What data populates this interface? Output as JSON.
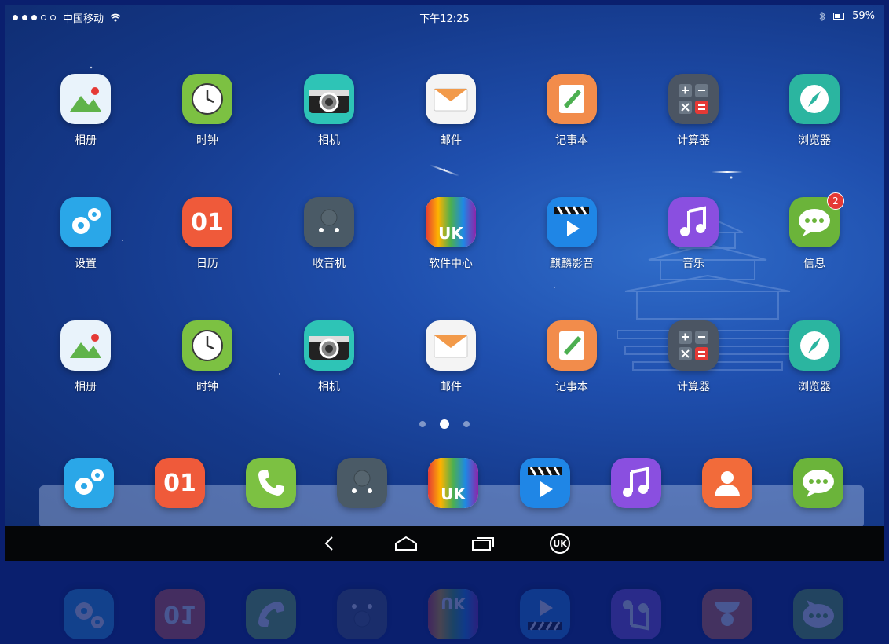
{
  "status_bar": {
    "carrier": "中国移动",
    "time": "下午12:25",
    "battery": "59%"
  },
  "home": {
    "rows": [
      [
        {
          "label": "相册",
          "icon": "gallery-icon",
          "color": "#e9f3fb"
        },
        {
          "label": "时钟",
          "icon": "clock-icon",
          "color": "#7cc142"
        },
        {
          "label": "相机",
          "icon": "camera-icon",
          "color": "#2ec4b6"
        },
        {
          "label": "邮件",
          "icon": "mail-icon",
          "color": "#f4f4f4"
        },
        {
          "label": "记事本",
          "icon": "notepad-icon",
          "color": "#f28c4b"
        },
        {
          "label": "计算器",
          "icon": "calculator-icon",
          "color": "#4b5563"
        },
        {
          "label": "浏览器",
          "icon": "browser-icon",
          "color": "#2bb5a0"
        }
      ],
      [
        {
          "label": "设置",
          "icon": "settings-icon",
          "color": "#2aa7e8"
        },
        {
          "label": "日历",
          "icon": "calendar-icon",
          "color": "#ef5a3a",
          "text": "01"
        },
        {
          "label": "收音机",
          "icon": "radio-icon",
          "color": "#4a5a66"
        },
        {
          "label": "软件中心",
          "icon": "app-store-icon",
          "color": "#ffffff",
          "text": "UK"
        },
        {
          "label": "麒麟影音",
          "icon": "video-player-icon",
          "color": "#1f86e6"
        },
        {
          "label": "音乐",
          "icon": "music-icon",
          "color": "#8a4fe0"
        },
        {
          "label": "信息",
          "icon": "messages-icon",
          "color": "#6bb43a",
          "badge": "2"
        }
      ],
      [
        {
          "label": "相册",
          "icon": "gallery-icon",
          "color": "#e9f3fb"
        },
        {
          "label": "时钟",
          "icon": "clock-icon",
          "color": "#7cc142"
        },
        {
          "label": "相机",
          "icon": "camera-icon",
          "color": "#2ec4b6"
        },
        {
          "label": "邮件",
          "icon": "mail-icon",
          "color": "#f4f4f4"
        },
        {
          "label": "记事本",
          "icon": "notepad-icon",
          "color": "#f28c4b"
        },
        {
          "label": "计算器",
          "icon": "calculator-icon",
          "color": "#4b5563"
        },
        {
          "label": "浏览器",
          "icon": "browser-icon",
          "color": "#2bb5a0"
        }
      ]
    ]
  },
  "pager": {
    "pages": 3,
    "active": 2
  },
  "dock": [
    {
      "icon": "settings-icon",
      "color": "#2aa7e8"
    },
    {
      "icon": "calendar-icon",
      "color": "#ef5a3a",
      "text": "01"
    },
    {
      "icon": "phone-icon",
      "color": "#7cc142"
    },
    {
      "icon": "radio-icon",
      "color": "#4a5a66"
    },
    {
      "icon": "app-store-icon",
      "color": "#ffffff",
      "text": "UK"
    },
    {
      "icon": "video-player-icon",
      "color": "#1f86e6"
    },
    {
      "icon": "music-icon",
      "color": "#8a4fe0"
    },
    {
      "icon": "contacts-icon",
      "color": "#f26b3a"
    },
    {
      "icon": "messages-icon",
      "color": "#6bb43a"
    }
  ],
  "navbar": [
    "back-icon",
    "home-icon",
    "recents-icon",
    "uk-logo-icon"
  ]
}
